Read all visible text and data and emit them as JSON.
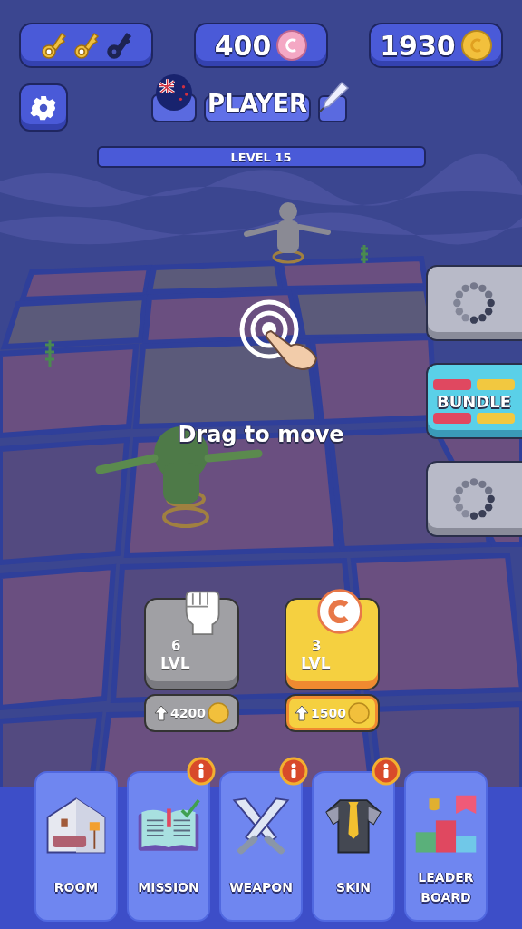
{
  "keys": [
    {
      "filled": true
    },
    {
      "filled": true
    },
    {
      "filled": false
    }
  ],
  "gems": "400",
  "coins": "1930",
  "player": {
    "name": "PLAYER"
  },
  "level": "LEVEL 15",
  "side_buttons": [
    {
      "kind": "loading"
    },
    {
      "kind": "bundle",
      "label": "BUNDLE"
    },
    {
      "kind": "loading"
    }
  ],
  "hint": "Drag to move",
  "upgrades": [
    {
      "kind": "power",
      "level": "6",
      "unit": "LVL",
      "cost": "4200"
    },
    {
      "kind": "coin",
      "level": "3",
      "unit": "LVL",
      "cost": "1500"
    }
  ],
  "nav": [
    {
      "kind": "room",
      "label": "ROOM",
      "alert": false
    },
    {
      "kind": "mission",
      "label": "MISSION",
      "alert": true
    },
    {
      "kind": "weapon",
      "label": "WEAPON",
      "alert": true
    },
    {
      "kind": "skin",
      "label": "SKIN",
      "alert": true
    },
    {
      "kind": "leaderboard",
      "label": "LEADER BOARD",
      "alert": false
    }
  ]
}
